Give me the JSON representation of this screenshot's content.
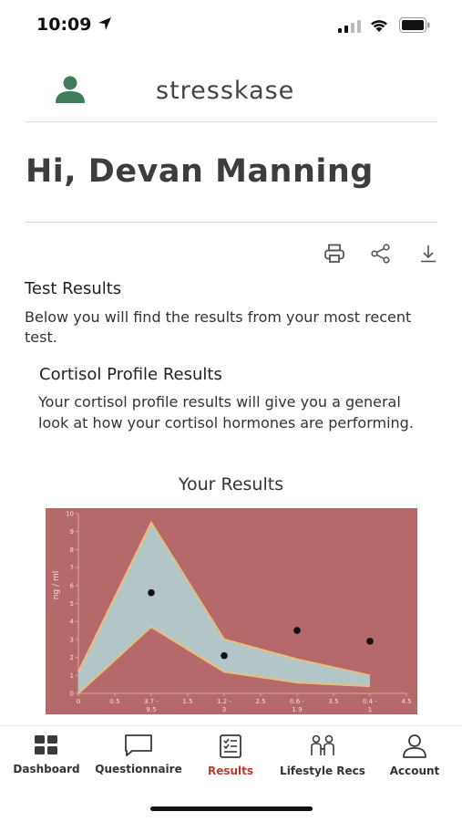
{
  "status_bar": {
    "time": "10:09"
  },
  "header": {
    "logo_text": "stresskase"
  },
  "greeting": "Hi, Devan Manning",
  "toolbar": {
    "icons": [
      "print-icon",
      "share-icon",
      "download-icon"
    ]
  },
  "test_results": {
    "title": "Test Results",
    "description": "Below you will find the results from your most recent test."
  },
  "cortisol": {
    "title": "Cortisol Profile Results",
    "description": "Your cortisol profile results will give you a general look at how your cortisol hormones are performing."
  },
  "results_heading": "Your Results",
  "colors": {
    "chart_bg": "#b5696a",
    "band_fill": "#b3c6c7",
    "band_edge": "#e6c07b",
    "active_tab": "#c0392b"
  },
  "chart_data": {
    "type": "area",
    "title": "",
    "ylabel": "ng / ml",
    "xlabel": "",
    "xlim": [
      0,
      4.5
    ],
    "ylim": [
      0,
      10
    ],
    "x_ticks": [
      "0",
      "0.5",
      "3.7 - 9.5",
      "1.5",
      "1.2 - 3",
      "2.5",
      "0.6 - 1.9",
      "3.5",
      "0.4 - 1",
      "4.5"
    ],
    "y_ticks": [
      "0",
      "1",
      "2",
      "3",
      "4",
      "5",
      "6",
      "7",
      "8",
      "9",
      "10"
    ],
    "reference_range": {
      "x": [
        0,
        1,
        2,
        3,
        4
      ],
      "upper": [
        1.2,
        9.5,
        3.0,
        1.9,
        1.0
      ],
      "lower": [
        0,
        3.7,
        1.2,
        0.6,
        0.4
      ]
    },
    "results": {
      "x": [
        1,
        2,
        3,
        4
      ],
      "y": [
        5.6,
        2.1,
        3.5,
        2.9
      ]
    }
  },
  "tabs": [
    {
      "label": "Dashboard",
      "icon": "dashboard-icon"
    },
    {
      "label": "Questionnaire",
      "icon": "chat-bubble-icon"
    },
    {
      "label": "Results",
      "icon": "clipboard-icon",
      "active": true
    },
    {
      "label": "Lifestyle Recs",
      "icon": "people-icon"
    },
    {
      "label": "Account",
      "icon": "person-icon"
    }
  ]
}
